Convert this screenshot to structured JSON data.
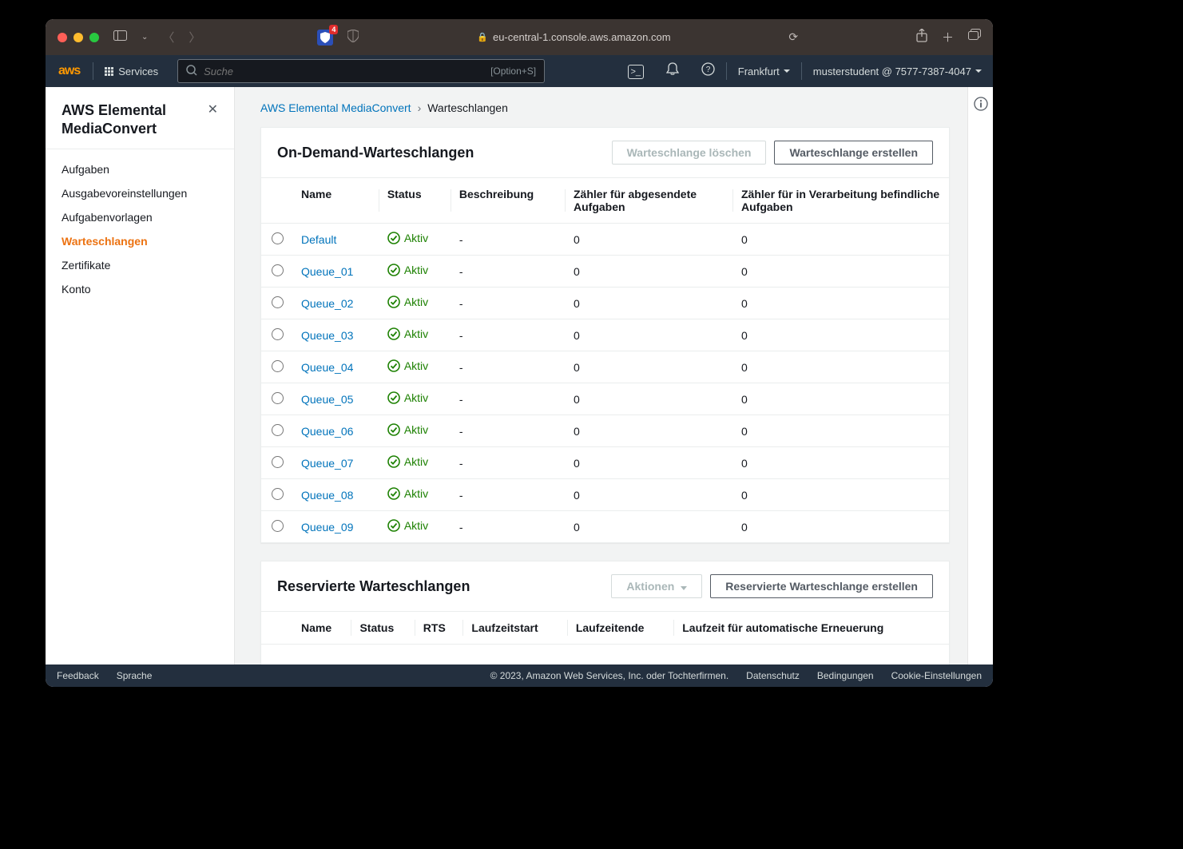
{
  "browser": {
    "url": "eu-central-1.console.aws.amazon.com",
    "ublock_badge": "4"
  },
  "aws_header": {
    "services_label": "Services",
    "search_placeholder": "Suche",
    "search_shortcut": "[Option+S]",
    "region": "Frankfurt",
    "account": "musterstudent @ 7577-7387-4047"
  },
  "sidebar": {
    "title": "AWS Elemental MediaConvert",
    "items": [
      "Aufgaben",
      "Ausgabevoreinstellungen",
      "Aufgabenvorlagen",
      "Warteschlangen",
      "Zertifikate",
      "Konto"
    ],
    "active_index": 3
  },
  "breadcrumb": {
    "root": "AWS Elemental MediaConvert",
    "current": "Warteschlangen"
  },
  "on_demand": {
    "title": "On-Demand-Warteschlangen",
    "delete_btn": "Warteschlange löschen",
    "create_btn": "Warteschlange erstellen",
    "columns": {
      "name": "Name",
      "status": "Status",
      "description": "Beschreibung",
      "submitted": "Zähler für abgesendete Aufgaben",
      "processing": "Zähler für in Verarbeitung befindliche Aufgaben"
    },
    "status_label": "Aktiv",
    "rows": [
      {
        "name": "Default",
        "status": "Aktiv",
        "description": "-",
        "submitted": "0",
        "processing": "0"
      },
      {
        "name": "Queue_01",
        "status": "Aktiv",
        "description": "-",
        "submitted": "0",
        "processing": "0"
      },
      {
        "name": "Queue_02",
        "status": "Aktiv",
        "description": "-",
        "submitted": "0",
        "processing": "0"
      },
      {
        "name": "Queue_03",
        "status": "Aktiv",
        "description": "-",
        "submitted": "0",
        "processing": "0"
      },
      {
        "name": "Queue_04",
        "status": "Aktiv",
        "description": "-",
        "submitted": "0",
        "processing": "0"
      },
      {
        "name": "Queue_05",
        "status": "Aktiv",
        "description": "-",
        "submitted": "0",
        "processing": "0"
      },
      {
        "name": "Queue_06",
        "status": "Aktiv",
        "description": "-",
        "submitted": "0",
        "processing": "0"
      },
      {
        "name": "Queue_07",
        "status": "Aktiv",
        "description": "-",
        "submitted": "0",
        "processing": "0"
      },
      {
        "name": "Queue_08",
        "status": "Aktiv",
        "description": "-",
        "submitted": "0",
        "processing": "0"
      },
      {
        "name": "Queue_09",
        "status": "Aktiv",
        "description": "-",
        "submitted": "0",
        "processing": "0"
      }
    ]
  },
  "reserved": {
    "title": "Reservierte Warteschlangen",
    "actions_btn": "Aktionen",
    "create_btn": "Reservierte Warteschlange erstellen",
    "columns": {
      "name": "Name",
      "status": "Status",
      "rts": "RTS",
      "start": "Laufzeitstart",
      "end": "Laufzeitende",
      "renew": "Laufzeit für automatische Erneuerung"
    }
  },
  "footer": {
    "feedback": "Feedback",
    "language": "Sprache",
    "copyright": "© 2023, Amazon Web Services, Inc. oder Tochterfirmen.",
    "privacy": "Datenschutz",
    "terms": "Bedingungen",
    "cookies": "Cookie-Einstellungen"
  }
}
